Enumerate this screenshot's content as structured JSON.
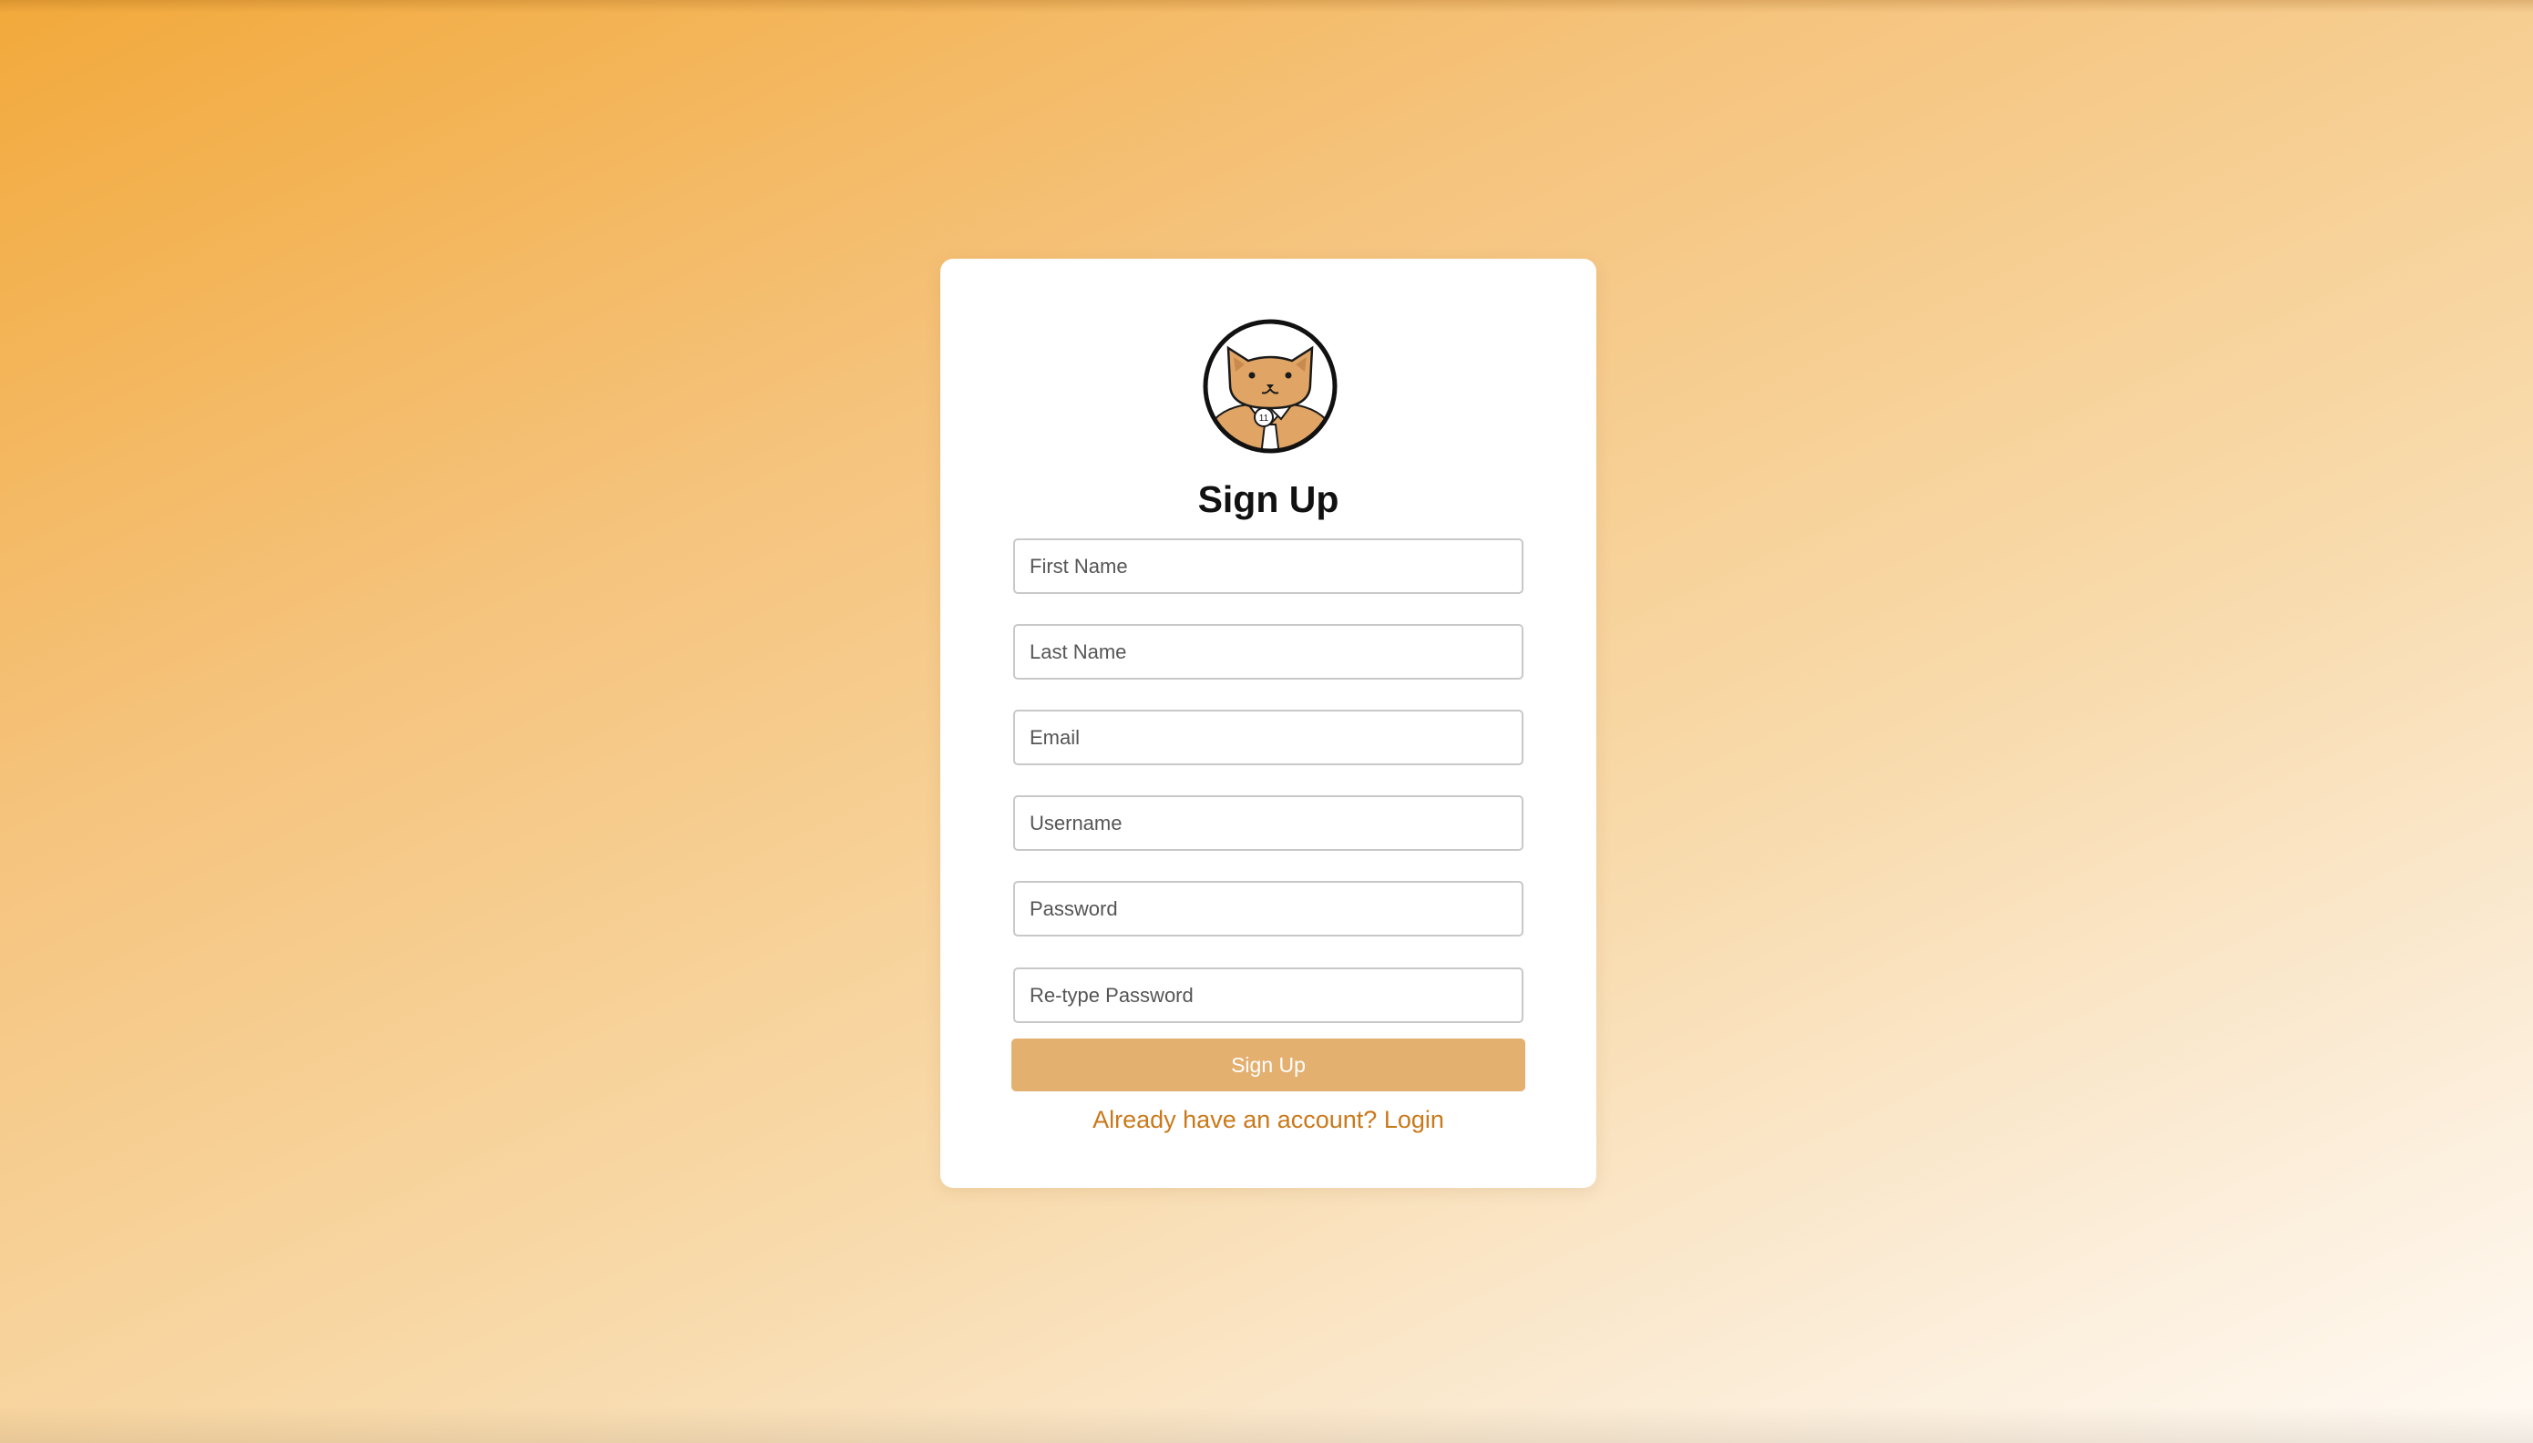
{
  "form": {
    "title": "Sign Up",
    "fields": {
      "first_name": {
        "placeholder": "First Name",
        "value": ""
      },
      "last_name": {
        "placeholder": "Last Name",
        "value": ""
      },
      "email": {
        "placeholder": "Email",
        "value": ""
      },
      "username": {
        "placeholder": "Username",
        "value": ""
      },
      "password": {
        "placeholder": "Password",
        "value": ""
      },
      "retype_password": {
        "placeholder": "Re-type Password",
        "value": ""
      }
    },
    "submit_label": "Sign Up",
    "login_link": "Already have an account? Login"
  },
  "avatar": {
    "icon": "cat-mascot-icon",
    "badge_text": "11"
  },
  "colors": {
    "accent": "#e3b070",
    "link": "#c9791a",
    "background_start": "#f2a93b",
    "background_end": "#fffaf4"
  }
}
